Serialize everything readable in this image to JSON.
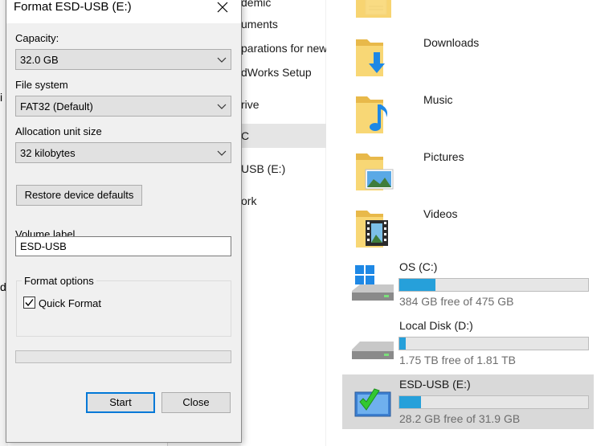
{
  "dialog": {
    "title": "Format ESD-USB (E:)",
    "capacity_label": "Capacity:",
    "capacity_value": "32.0 GB",
    "filesystem_label": "File system",
    "filesystem_value": "FAT32 (Default)",
    "allocation_label": "Allocation unit size",
    "allocation_value": "32 kilobytes",
    "restore_label": "Restore device defaults",
    "volume_label": "Volume label",
    "volume_value": "ESD-USB",
    "format_options_label": "Format options",
    "quick_format_label": "Quick Format",
    "quick_format_checked": true,
    "progress": 0,
    "start_label": "Start",
    "close_label": "Close",
    "accent_color": "#0078d7"
  },
  "explorer": {
    "left_fragments": [
      "i",
      "d"
    ],
    "nav_items": [
      {
        "label": "demic",
        "selected": false
      },
      {
        "label": "uments",
        "selected": false
      },
      {
        "label": "parations for new",
        "selected": false
      },
      {
        "label": "dWorks Setup",
        "selected": false
      },
      {
        "label": "rive",
        "selected": false
      },
      {
        "label": "C",
        "selected": true
      },
      {
        "label": "USB (E:)",
        "selected": false
      },
      {
        "label": "ork",
        "selected": false
      }
    ],
    "folders": [
      {
        "label": "Downloads",
        "icon": "downloads-folder-icon"
      },
      {
        "label": "Music",
        "icon": "music-folder-icon"
      },
      {
        "label": "Pictures",
        "icon": "pictures-folder-icon"
      },
      {
        "label": "Videos",
        "icon": "videos-folder-icon"
      }
    ],
    "drives": [
      {
        "name": "OS (C:)",
        "free_text": "384 GB free of 475 GB",
        "used_fraction": 0.192,
        "icon": "windows-drive-icon",
        "selected": false
      },
      {
        "name": "Local Disk (D:)",
        "free_text": "1.75 TB free of 1.81 TB",
        "used_fraction": 0.033,
        "icon": "hard-drive-icon",
        "selected": false
      },
      {
        "name": "ESD-USB (E:)",
        "free_text": "28.2 GB free of 31.9 GB",
        "used_fraction": 0.116,
        "icon": "usb-drive-icon",
        "selected": true
      }
    ],
    "bar_color": "#26a0da"
  }
}
